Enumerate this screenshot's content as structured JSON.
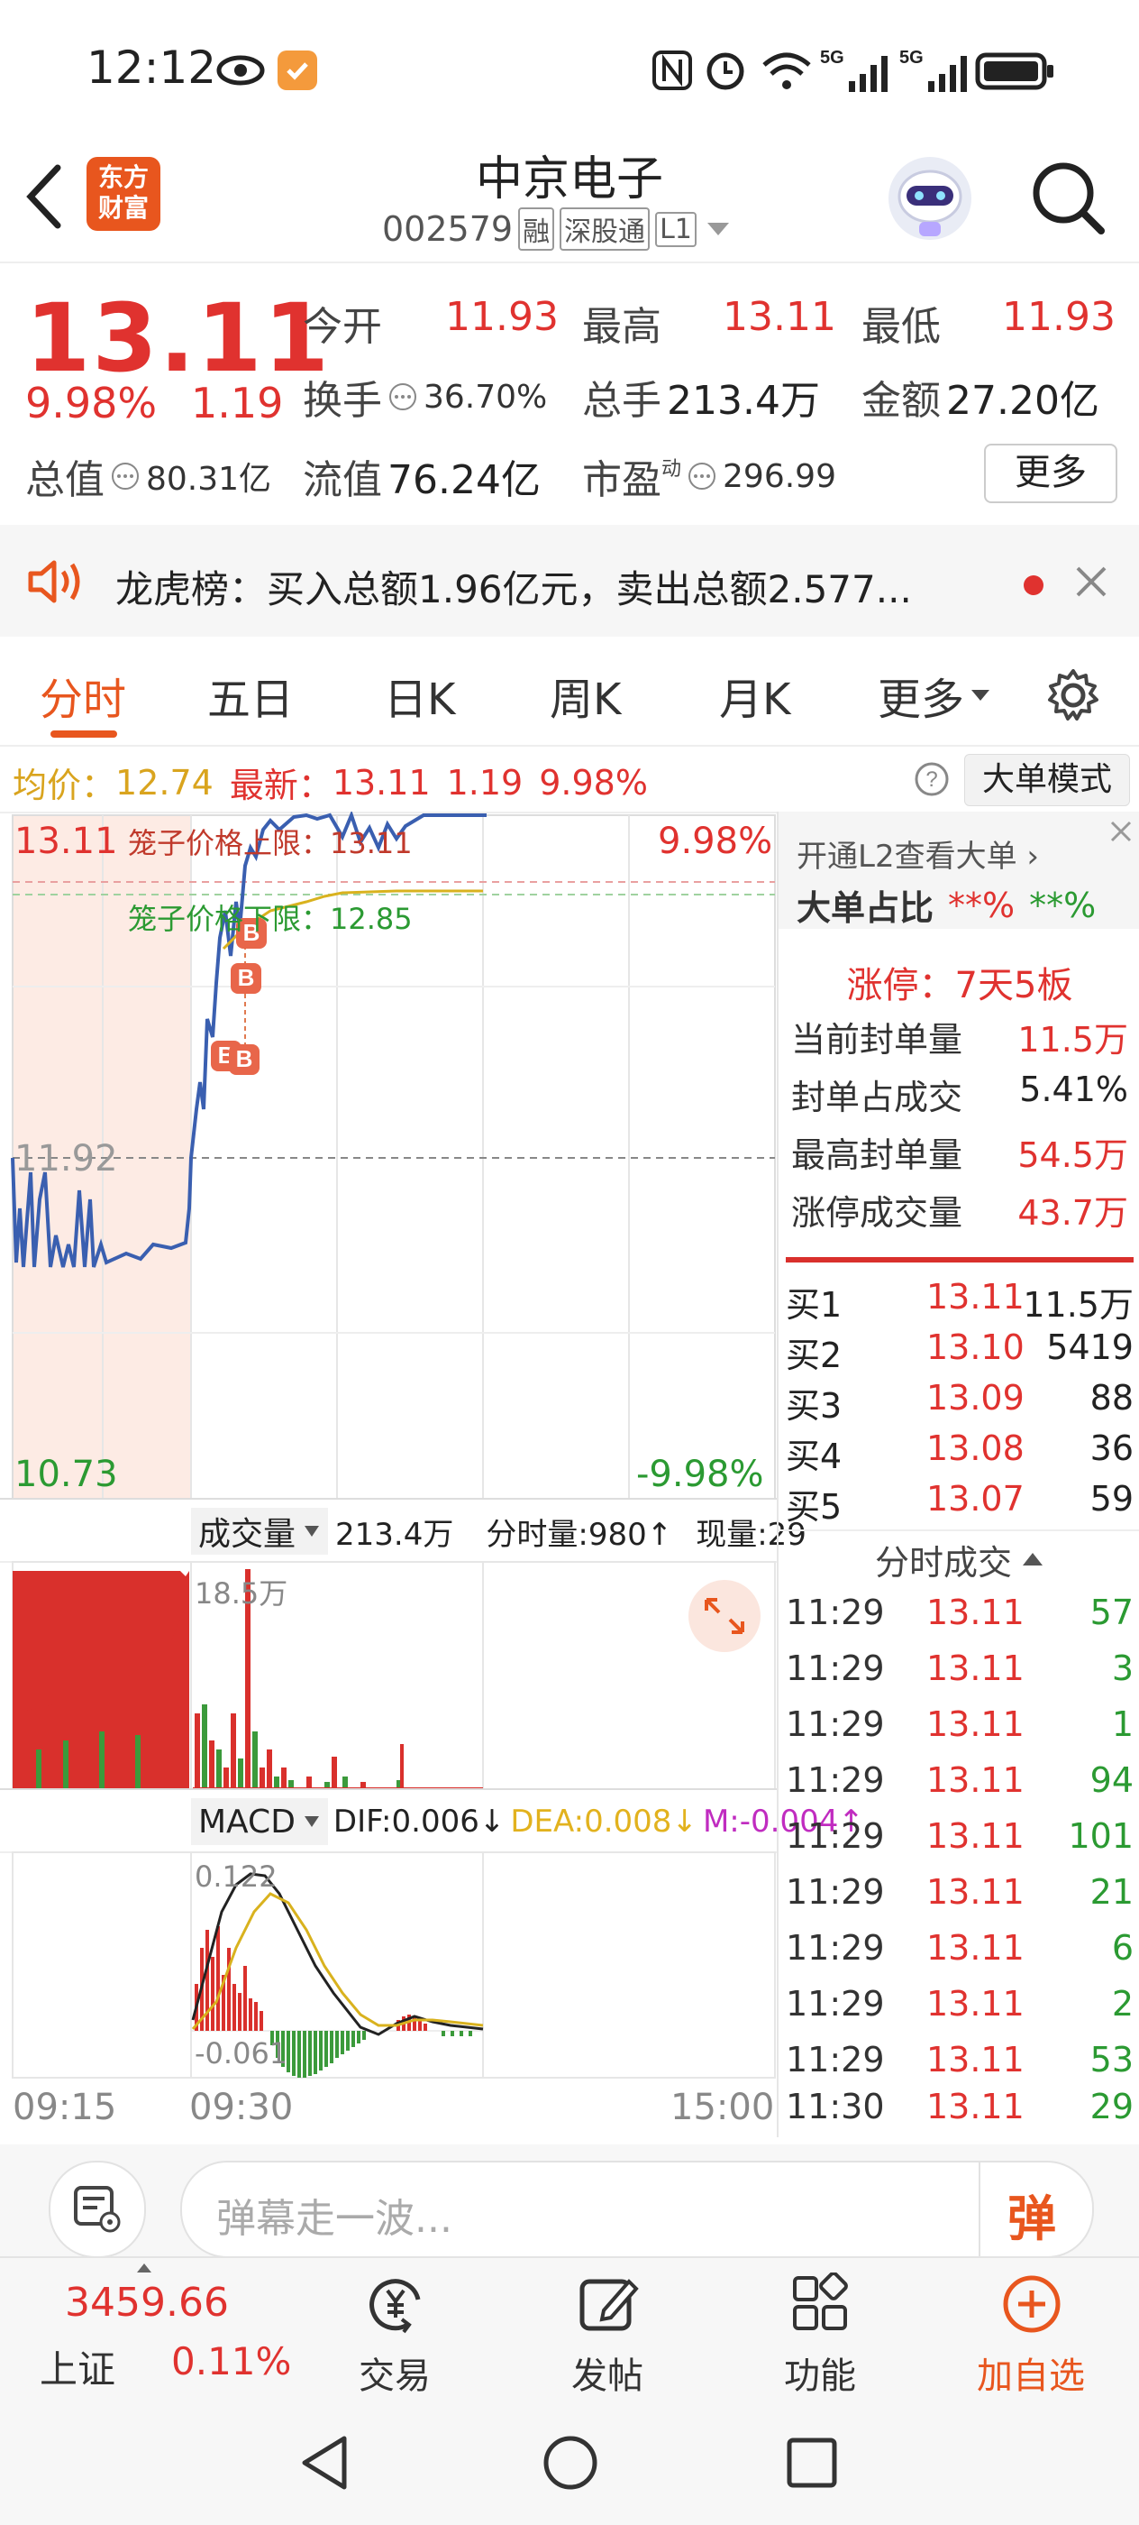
{
  "status_bar": {
    "time": "12:12"
  },
  "header": {
    "logo_line1": "东方",
    "logo_line2": "财富",
    "stock_name": "中京电子",
    "stock_code": "002579",
    "tag_margin": "融",
    "tag_connect": "深股通",
    "tag_level": "L1"
  },
  "quote": {
    "price": "13.11",
    "change_pct": "9.98%",
    "change_amt": "1.19",
    "open_label": "今开",
    "open_value": "11.93",
    "high_label": "最高",
    "high_value": "13.11",
    "low_label": "最低",
    "low_value": "11.93",
    "turnover_label": "换手",
    "turnover_value": "36.70%",
    "volume_label": "总手",
    "volume_value": "213.4万",
    "amount_label": "金额",
    "amount_value": "27.20亿",
    "mktcap_label": "总值",
    "mktcap_value": "80.31亿",
    "float_label": "流值",
    "float_value": "76.24亿",
    "pe_label": "市盈",
    "pe_sup": "动",
    "pe_value": "296.99",
    "more_button": "更多"
  },
  "news": {
    "text": "龙虎榜：买入总额1.96亿元，卖出总额2.577..."
  },
  "tabs": {
    "t1": "分时",
    "t2": "五日",
    "t3": "日K",
    "t4": "周K",
    "t5": "月K",
    "t6": "更多"
  },
  "chart_info": {
    "avg_label": "均价：",
    "avg_value": "12.74",
    "latest_label": "最新：",
    "latest_value": "13.11",
    "latest_change": "1.19",
    "latest_pct": "9.98%",
    "mode_button": "大单模式"
  },
  "price_chart": {
    "top_price": "13.11",
    "top_pct": "9.98%",
    "mid_price": "11.92",
    "bottom_price": "10.73",
    "bottom_pct": "-9.98%",
    "cage_upper": "笼子价格上限：13.11",
    "cage_lower": "笼子价格下限：12.85"
  },
  "volume_chart": {
    "label": "成交量",
    "total": "213.4万",
    "tick_vol": "分时量:980↑",
    "current_vol": "现量:29",
    "max_label": "18.5万"
  },
  "macd_chart": {
    "label": "MACD",
    "dif": "DIF:0.006↓",
    "dea": "DEA:0.008↓",
    "m": "M:-0.004↑",
    "top": "0.122",
    "bottom": "-0.061"
  },
  "time_axis": {
    "start": "09:15",
    "open": "09:30",
    "end": "15:00"
  },
  "side_panel": {
    "l2_link": "开通L2查看大单 ›",
    "big_order_label": "大单占比",
    "big_order_v1": "**%",
    "big_order_v2": "**%",
    "limit_title": "涨停：7天5板",
    "stats": [
      {
        "label": "当前封单量",
        "value": "11.5万"
      },
      {
        "label": "封单占成交",
        "value": "5.41%"
      },
      {
        "label": "最高封单量",
        "value": "54.5万"
      },
      {
        "label": "涨停成交量",
        "value": "43.7万"
      }
    ],
    "bids": [
      {
        "label": "买1",
        "price": "13.11",
        "vol": "11.5万"
      },
      {
        "label": "买2",
        "price": "13.10",
        "vol": "5419"
      },
      {
        "label": "买3",
        "price": "13.09",
        "vol": "88"
      },
      {
        "label": "买4",
        "price": "13.08",
        "vol": "36"
      },
      {
        "label": "买5",
        "price": "13.07",
        "vol": "59"
      }
    ],
    "trades_title": "分时成交",
    "trades": [
      {
        "time": "11:29",
        "price": "13.11",
        "vol": "57"
      },
      {
        "time": "11:29",
        "price": "13.11",
        "vol": "3"
      },
      {
        "time": "11:29",
        "price": "13.11",
        "vol": "1"
      },
      {
        "time": "11:29",
        "price": "13.11",
        "vol": "94"
      },
      {
        "time": "11:29",
        "price": "13.11",
        "vol": "101"
      },
      {
        "time": "11:29",
        "price": "13.11",
        "vol": "21"
      },
      {
        "time": "11:29",
        "price": "13.11",
        "vol": "6"
      },
      {
        "time": "11:29",
        "price": "13.11",
        "vol": "2"
      },
      {
        "time": "11:29",
        "price": "13.11",
        "vol": "53"
      },
      {
        "time": "11:30",
        "price": "13.11",
        "vol": "29"
      }
    ]
  },
  "danmu": {
    "placeholder": "弹幕走一波...",
    "button": "弹"
  },
  "tabbar": {
    "index_value": "3459.66",
    "index_name": "上证",
    "index_pct": "0.11%",
    "trade": "交易",
    "post": "发帖",
    "features": "功能",
    "add_watch": "加自选"
  },
  "colors": {
    "up": "#e0322f",
    "down": "#2b9a32",
    "accent": "#e8561e",
    "line": "#3a5fb0",
    "avg": "#d9b21e"
  }
}
